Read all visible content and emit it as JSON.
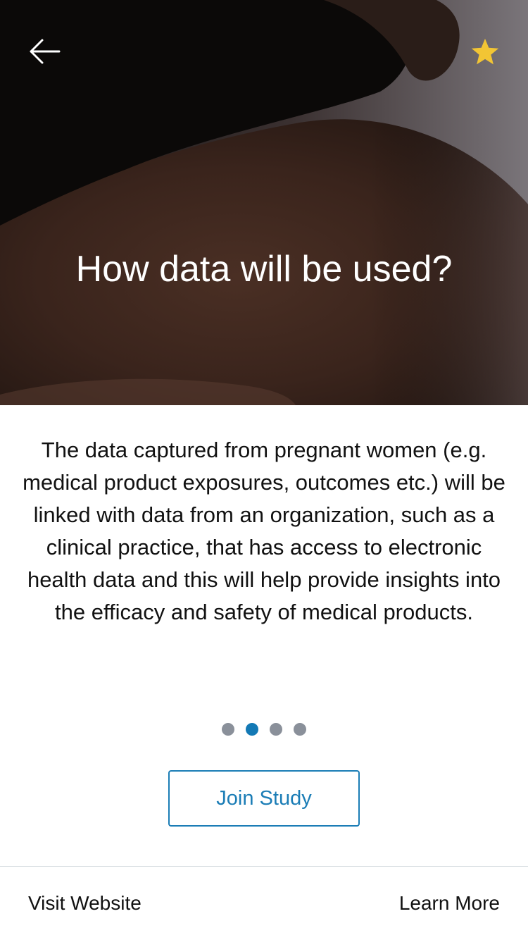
{
  "hero": {
    "title": "How data will be used?"
  },
  "nav": {
    "back_icon": "back-arrow-icon",
    "favorite_icon": "star-icon"
  },
  "description": "The data captured from pregnant women (e.g. medical product exposures, outcomes etc.) will be linked with data from an organization, such as a clinical practice, that has access to electronic health data and this will help provide insights into the efficacy and safety of medical products.",
  "pager": {
    "total": 4,
    "active": 2
  },
  "join_button": "Join Study",
  "footer": {
    "left": "Visit Website",
    "right": "Learn More"
  },
  "colors": {
    "accent": "#1b7db6",
    "star": "#f2c534",
    "dot_inactive": "#8a909a"
  }
}
